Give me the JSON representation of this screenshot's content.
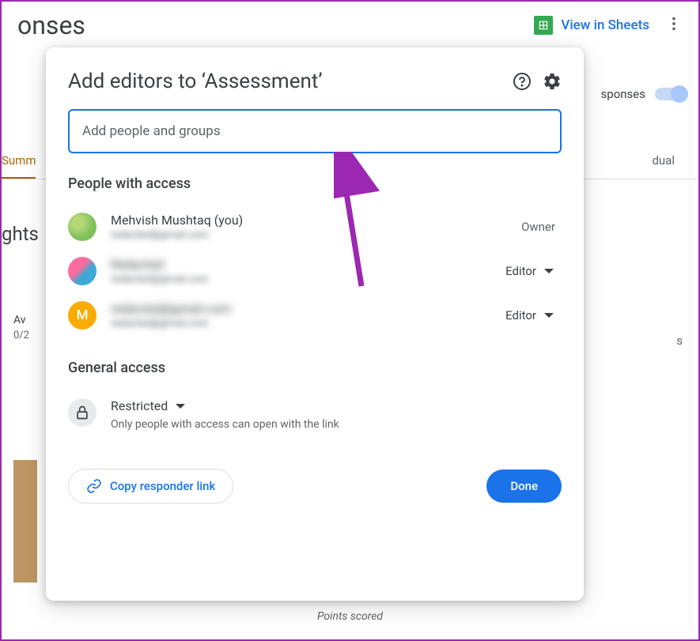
{
  "background": {
    "title": "onses",
    "view_sheets": "View in Sheets",
    "toggle_label": "sponses",
    "tab_summary": "Summ",
    "tab_individual": "dual",
    "insights": "ghts",
    "stat_label": "Av",
    "stat_value": "0/2",
    "right_s": "s",
    "points_scored": "Points scored"
  },
  "modal": {
    "title": "Add editors to ‘Assessment’",
    "input_placeholder": "Add people and groups",
    "people_section": "People with access",
    "people": [
      {
        "name": "Mehvish Mushtaq (you)",
        "email": "redacted@gmail.com",
        "role": "Owner",
        "avatar_letter": ""
      },
      {
        "name": "Redacted",
        "email": "redacted@gmail.com",
        "role": "Editor",
        "avatar_letter": ""
      },
      {
        "name": "redacted@gmail.com",
        "email": "redacted@gmail.com",
        "role": "Editor",
        "avatar_letter": "M"
      }
    ],
    "general_section": "General access",
    "access_mode": "Restricted",
    "access_desc": "Only people with access can open with the link",
    "copy_link": "Copy responder link",
    "done": "Done"
  }
}
